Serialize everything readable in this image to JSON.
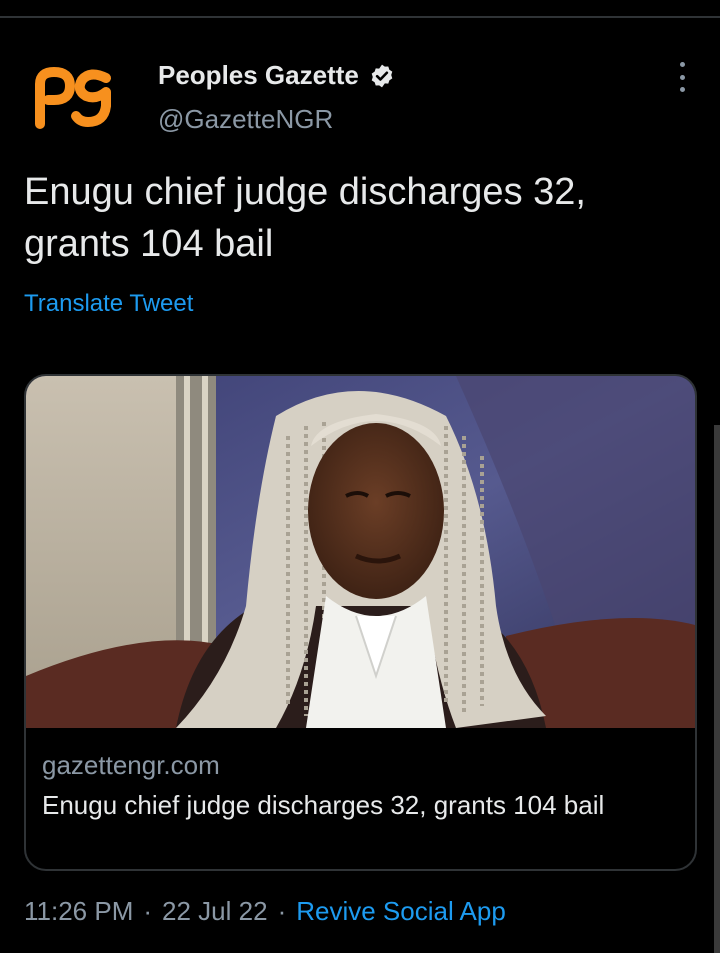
{
  "author": {
    "name": "Peoples Gazette",
    "handle": "@GazetteNGR",
    "logo_text": "pg",
    "verified": true
  },
  "tweet": {
    "text": "Enugu chief judge discharges 32, grants 104 bail",
    "translate_label": "Translate Tweet"
  },
  "card": {
    "domain": "gazettengr.com",
    "title": "Enugu chief judge discharges 32, grants 104 bail",
    "image_subject": "portrait of judge in white ceremonial wig"
  },
  "meta": {
    "time": "11:26 PM",
    "separator": "·",
    "date": "22 Jul 22",
    "source": "Revive Social App"
  },
  "colors": {
    "background": "#000000",
    "text_primary": "#e7e9ea",
    "text_secondary": "#8b98a5",
    "link": "#1d9bf0",
    "logo_orange": "#f7901e",
    "border": "#2f3336"
  },
  "icons": {
    "verified": "verified-badge-icon",
    "more": "more-vertical-icon"
  }
}
